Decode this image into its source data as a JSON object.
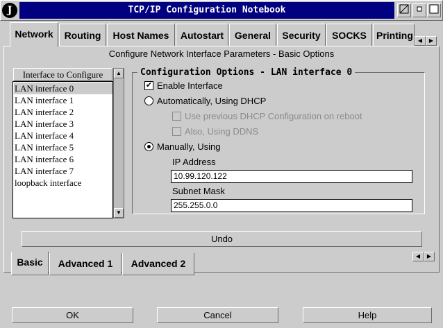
{
  "window": {
    "title": "TCP/IP Configuration Notebook",
    "sys_icon": "J",
    "controls": [
      "resize-icon",
      "minimize-icon",
      "maximize-icon"
    ]
  },
  "tabs": [
    "Network",
    "Routing",
    "Host Names",
    "Autostart",
    "General",
    "Security",
    "SOCKS",
    "Printing"
  ],
  "active_tab": "Network",
  "page_subtitle": "Configure Network Interface Parameters - Basic Options",
  "interface_list": {
    "header": "Interface to Configure",
    "items": [
      "LAN interface 0",
      "LAN interface 1",
      "LAN interface 2",
      "LAN interface 3",
      "LAN interface 4",
      "LAN interface 5",
      "LAN interface 6",
      "LAN interface 7",
      "loopback interface"
    ],
    "selected_index": 0
  },
  "config": {
    "title": "Configuration Options - LAN interface 0",
    "enable_interface": {
      "label": "Enable Interface",
      "checked": true
    },
    "dhcp": {
      "label": "Automatically, Using DHCP",
      "selected": false
    },
    "use_previous_dhcp": {
      "label": "Use previous DHCP Configuration on reboot",
      "checked": false,
      "disabled": true
    },
    "ddns": {
      "label": "Also, Using DDNS",
      "checked": false,
      "disabled": true
    },
    "manual": {
      "label": "Manually, Using",
      "selected": true
    },
    "ip_address": {
      "label": "IP Address",
      "value": "10.99.120.122"
    },
    "subnet_mask": {
      "label": "Subnet Mask",
      "value": "255.255.0.0"
    }
  },
  "undo_label": "Undo",
  "subtabs": [
    "Basic",
    "Advanced 1",
    "Advanced 2"
  ],
  "active_subtab": "Basic",
  "buttons": {
    "ok": "OK",
    "cancel": "Cancel",
    "help": "Help"
  },
  "colors": {
    "title_bar": "#000080",
    "face": "#cccccc"
  }
}
